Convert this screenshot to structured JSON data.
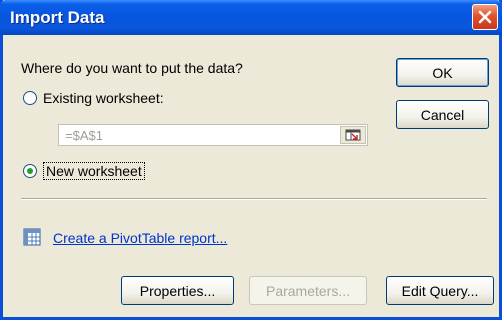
{
  "window": {
    "title": "Import Data"
  },
  "prompt": "Where do you want to put the data?",
  "options": {
    "existing_label": "Existing worksheet:",
    "existing_selected": false,
    "new_label": "New worksheet",
    "new_selected": true
  },
  "reference": {
    "value": "=$A$1"
  },
  "pivot_link": "Create a PivotTable report...",
  "buttons": {
    "ok": "OK",
    "cancel": "Cancel",
    "properties": "Properties...",
    "parameters": "Parameters...",
    "edit_query": "Edit Query..."
  },
  "colors": {
    "title_bar": "#0a56db",
    "dialog_bg": "#ece9d8",
    "link": "#0033cc",
    "close_button": "#e2522c"
  }
}
